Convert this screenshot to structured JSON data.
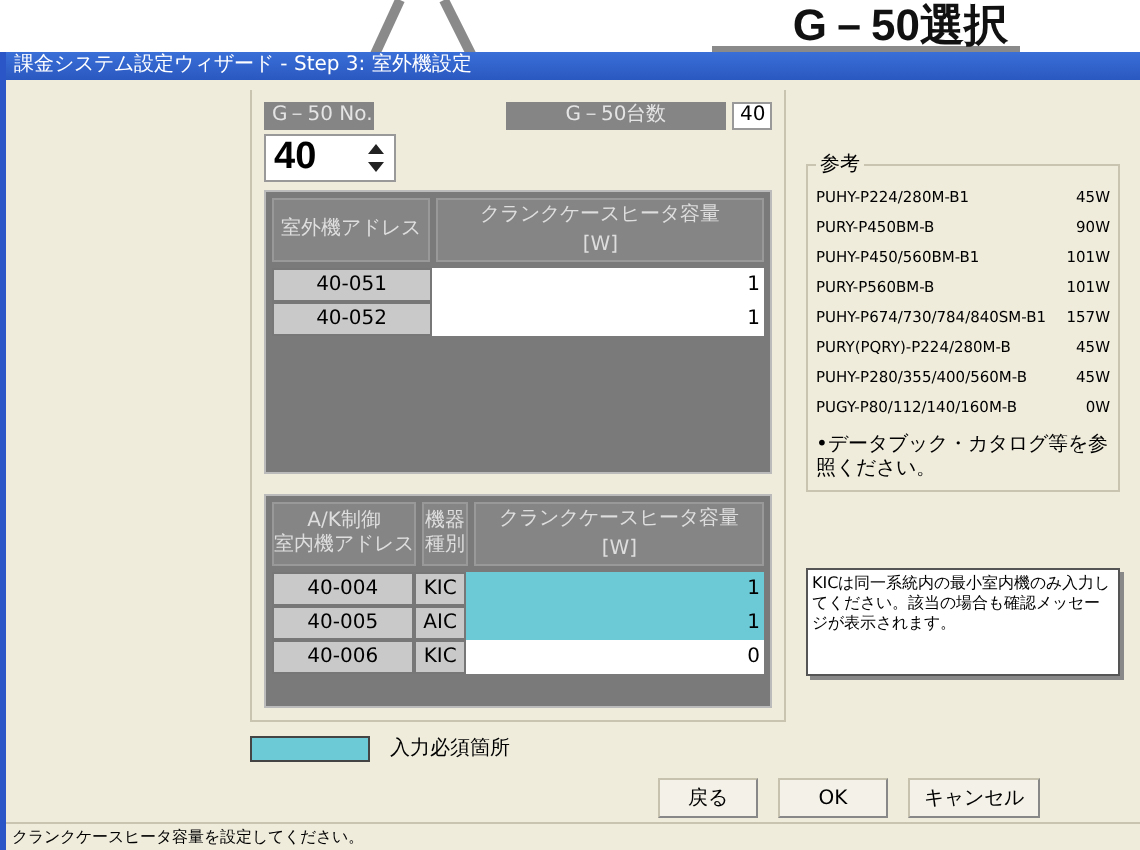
{
  "callout": {
    "text": "G－50選択"
  },
  "window": {
    "title": "課金システム設定ウィザード - Step 3: 室外機設定"
  },
  "g50_no": {
    "label": "G－50 No.",
    "value": "40"
  },
  "g50_count": {
    "label": "G－50台数",
    "value": "40"
  },
  "outdoor_table": {
    "columns": [
      {
        "label": "室外機アドレス"
      },
      {
        "label": "クランクケースヒータ容量",
        "unit": "[W]"
      }
    ],
    "rows": [
      {
        "address": "40-051",
        "value": "1",
        "required": false
      },
      {
        "address": "40-052",
        "value": "1",
        "required": false
      }
    ]
  },
  "indoor_table": {
    "columns": [
      {
        "lines": [
          "A/K制御",
          "室内機アドレス"
        ]
      },
      {
        "lines": [
          "機器",
          "種別"
        ]
      },
      {
        "label": "クランクケースヒータ容量",
        "unit": "[W]"
      }
    ],
    "rows": [
      {
        "address": "40-004",
        "type": "KIC",
        "value": "1",
        "required": true
      },
      {
        "address": "40-005",
        "type": "AIC",
        "value": "1",
        "required": true
      },
      {
        "address": "40-006",
        "type": "KIC",
        "value": "0",
        "required": false
      }
    ]
  },
  "legend": {
    "label": "入力必須箇所"
  },
  "reference": {
    "title": "参考",
    "items": [
      {
        "model": "PUHY-P224/280M-B1",
        "watt": "45W"
      },
      {
        "model": "PURY-P450BM-B",
        "watt": "90W"
      },
      {
        "model": "PUHY-P450/560BM-B1",
        "watt": "101W"
      },
      {
        "model": "PURY-P560BM-B",
        "watt": "101W"
      },
      {
        "model": "PUHY-P674/730/784/840SM-B1",
        "watt": "157W"
      },
      {
        "model": "PURY(PQRY)-P224/280M-B",
        "watt": "45W"
      },
      {
        "model": "PUHY-P280/355/400/560M-B",
        "watt": "45W"
      },
      {
        "model": "PUGY-P80/112/140/160M-B",
        "watt": "0W"
      }
    ],
    "note": "•データブック・カタログ等を参照ください。"
  },
  "message": "KICは同一系統内の最小室内機のみ入力してください。該当の場合も確認メッセージが表示されます。",
  "buttons": [
    {
      "label": "戻る"
    },
    {
      "label": "OK"
    },
    {
      "label": "キャンセル"
    }
  ],
  "status_bar": "クランクケースヒータ容量を設定してください。"
}
